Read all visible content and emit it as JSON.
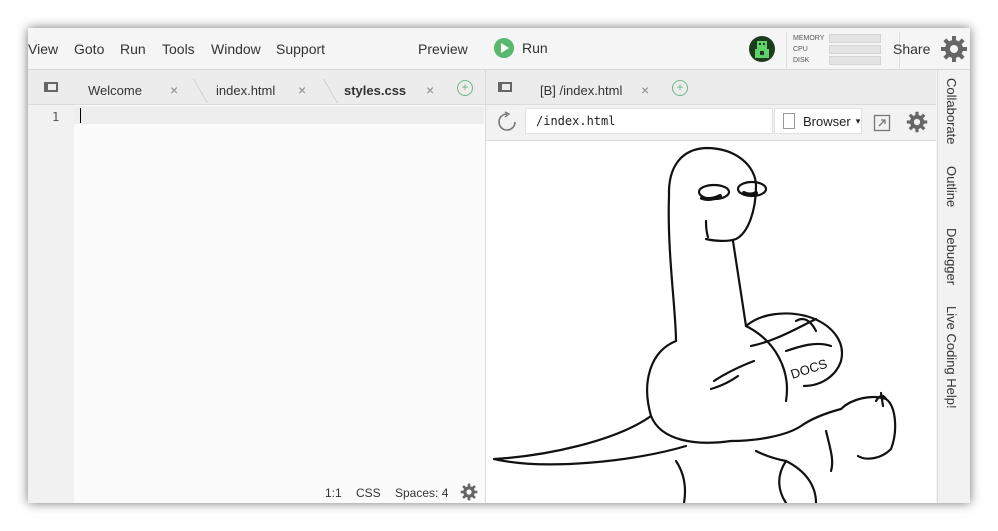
{
  "menubar": {
    "items": [
      "View",
      "Goto",
      "Run",
      "Tools",
      "Window",
      "Support"
    ],
    "preview_label": "Preview",
    "run_label": "Run",
    "meters": [
      "MEMORY",
      "CPU",
      "DISK"
    ],
    "share_label": "Share"
  },
  "editor": {
    "tabs": [
      {
        "label": "Welcome",
        "active": false
      },
      {
        "label": "index.html",
        "active": false
      },
      {
        "label": "styles.css",
        "active": true
      }
    ],
    "close_glyph": "×",
    "line_number": "1",
    "status": {
      "position": "1:1",
      "mode": "CSS",
      "indent": "Spaces: 4"
    }
  },
  "preview": {
    "tab_label": "[B] /index.html",
    "close_glyph": "×",
    "url": "/index.html",
    "browser_label": "Browser",
    "image_text": "DOCS"
  },
  "sidebar": {
    "tabs": [
      "Collaborate",
      "Outline",
      "Debugger",
      "Live Coding Help!"
    ]
  },
  "icons": {
    "run": "play-icon",
    "settings": "gear-icon",
    "refresh": "refresh-icon",
    "popout": "popout-icon",
    "add": "plus-icon"
  },
  "colors": {
    "run_green": "#56b96f",
    "add_green": "#6db784"
  }
}
